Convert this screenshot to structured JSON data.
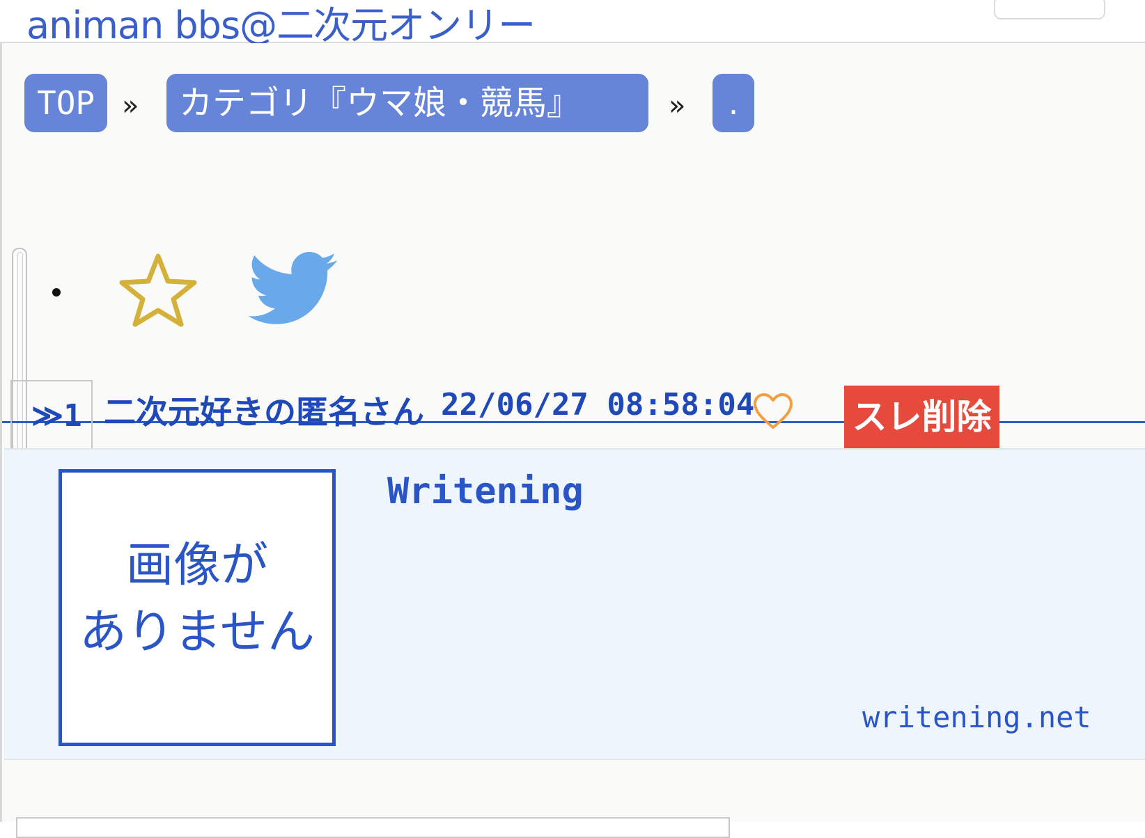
{
  "header": {
    "site_title": "animan bbs@二次元オンリー"
  },
  "breadcrumb": {
    "top": "TOP",
    "separator": "»",
    "category": "カテゴリ『ウマ娘・競馬』",
    "thread": "."
  },
  "share": {
    "icons": [
      "star-icon",
      "twitter-icon"
    ],
    "star_color": "#d4b13a",
    "twitter_color": "#6aa9e9"
  },
  "post": {
    "number": "≫1",
    "name": "二次元好きの匿名さん",
    "datetime": "22/06/27 08:58:04",
    "like_icon": "heart-outline-icon",
    "like_color": "#f0a042",
    "delete_label": "スレ削除",
    "delete_color": "#e64a3d"
  },
  "link_card": {
    "thumb_text_line1": "画像が",
    "thumb_text_line2": "ありません",
    "title": "Writening",
    "domain": "writening.net",
    "accent_color": "#2a55c6"
  }
}
